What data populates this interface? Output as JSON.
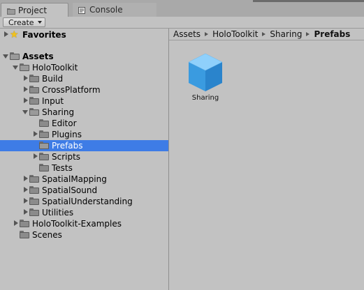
{
  "tabs": [
    {
      "label": "Project",
      "icon": "folder-icon",
      "active": true
    },
    {
      "label": "Console",
      "icon": "console-icon",
      "active": false
    }
  ],
  "toolbar": {
    "create_label": "Create"
  },
  "tree": {
    "favorites": "Favorites",
    "assets": "Assets",
    "holotoolkit": "HoloToolkit",
    "build": "Build",
    "crossplatform": "CrossPlatform",
    "input": "Input",
    "sharing": "Sharing",
    "editor": "Editor",
    "plugins": "Plugins",
    "prefabs": "Prefabs",
    "scripts": "Scripts",
    "tests": "Tests",
    "spatialmapping": "SpatialMapping",
    "spatialsound": "SpatialSound",
    "spatialunderstanding": "SpatialUnderstanding",
    "utilities": "Utilities",
    "holotoolkit_examples": "HoloToolkit-Examples",
    "scenes": "Scenes"
  },
  "breadcrumb": [
    "Assets",
    "HoloToolkit",
    "Sharing",
    "Prefabs"
  ],
  "asset_items": [
    {
      "label": "Sharing",
      "icon": "prefab-cube-icon"
    }
  ],
  "colors": {
    "selection": "#3e7ce6",
    "panel": "#c2c2c2",
    "tabbar": "#a9a9a9",
    "cube": "#3fa6e8"
  }
}
